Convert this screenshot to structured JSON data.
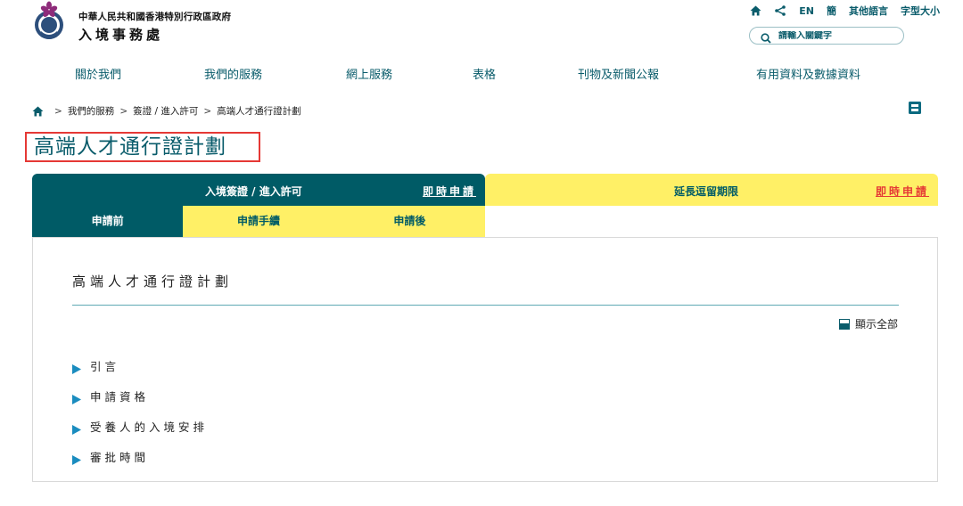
{
  "header": {
    "gov_name": "中華人民共和國香港特別行政區政府",
    "dept_name": "入境事務處"
  },
  "utility": {
    "home_icon": "home-icon",
    "share_icon": "share-icon",
    "lang_en": "EN",
    "lang_sc": "簡",
    "other_langs": "其他語言",
    "font_size": "字型大小"
  },
  "search": {
    "placeholder": "請輸入關鍵字"
  },
  "nav": {
    "items": [
      "關於我們",
      "我們的服務",
      "網上服務",
      "表格",
      "刊物及新聞公報",
      "有用資料及數據資料"
    ]
  },
  "breadcrumb": {
    "items": [
      "我們的服務",
      "簽證 / 進入許可",
      "高端人才通行證計劃"
    ]
  },
  "page": {
    "title": "高端人才通行證計劃"
  },
  "tabs": {
    "primary": [
      {
        "label": "入境簽證 / 進入許可",
        "apply": "即時申請",
        "active": true
      },
      {
        "label": "延長逗留期限",
        "apply": "即時申請",
        "active": false
      }
    ],
    "secondary": [
      {
        "label": "申請前",
        "active": true
      },
      {
        "label": "申請手續",
        "active": false
      },
      {
        "label": "申請後",
        "active": false
      }
    ]
  },
  "panel": {
    "heading": "高端人才通行證計劃",
    "show_all": "顯示全部",
    "sections": [
      "引言",
      "申請資格",
      "受養人的入境安排",
      "審批時間"
    ]
  },
  "colors": {
    "teal": "#005b66",
    "yellow": "#fff066",
    "red": "#e53935"
  }
}
